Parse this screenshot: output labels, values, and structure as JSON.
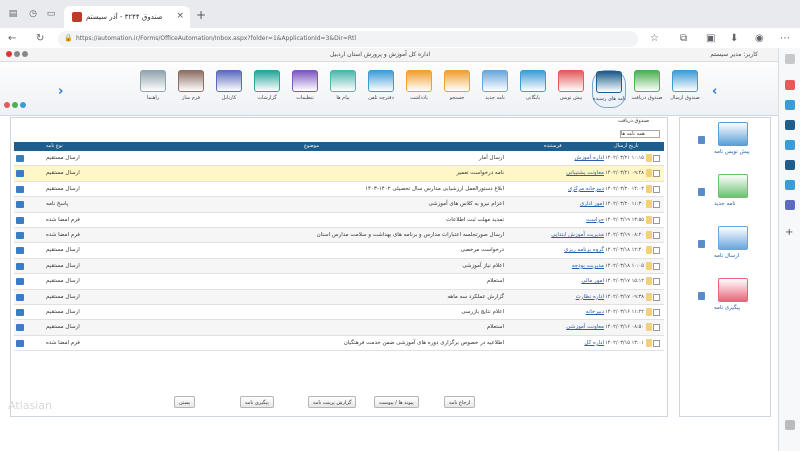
{
  "browser": {
    "tab_title": "صندوق ۳۲۴۴ - آذر سیستم",
    "url": "https://automation.ir/Forms/OfficeAutomation/Inbox.aspx?folder=1&ApplicationId=3&Dir=Rtl",
    "colors": {
      "tabbar": "#e8eaed",
      "accent": "#1f5d8c"
    }
  },
  "app": {
    "title": "اداره کل آموزش و پرورش استان اردبیل",
    "user": "کاربر: مدیر سیستم"
  },
  "toolbar": {
    "items": [
      {
        "label": "صندوق ارسال",
        "color": "#3f9bd6"
      },
      {
        "label": "صندوق دریافت",
        "color": "#4caf50"
      },
      {
        "label": "نامه های رسیده",
        "color": "#1f5d8c"
      },
      {
        "label": "پیش نویس",
        "color": "#e35b5b"
      },
      {
        "label": "بایگانی",
        "color": "#3f9bd6"
      },
      {
        "label": "نامه جدید",
        "color": "#6aa6de"
      },
      {
        "label": "جستجو",
        "color": "#f0a030"
      },
      {
        "label": "یادداشت",
        "color": "#f0a030"
      },
      {
        "label": "دفترچه تلفن",
        "color": "#3f9bd6"
      },
      {
        "label": "پیام ها",
        "color": "#4db6ac"
      },
      {
        "label": "تنظیمات",
        "color": "#7e57c2"
      },
      {
        "label": "گزارشات",
        "color": "#26a69a"
      },
      {
        "label": "کارتابل",
        "color": "#5c6bc0"
      },
      {
        "label": "فرم ساز",
        "color": "#8d6e63"
      },
      {
        "label": "راهنما",
        "color": "#90a4ae"
      }
    ]
  },
  "main": {
    "breadcrumb": "صندوق دریافت",
    "filter_label": "همه نامه ها",
    "columns": {
      "date": "تاریخ ارسال",
      "sender": "فرستنده",
      "subject": "موضوع",
      "from": "نوع نامه"
    },
    "rows": [
      {
        "date": "۱۴۰۲/۰۳/۲۱ ۱۰:۱۵",
        "sender": "اداره آموزش",
        "subject": "ارسال آمار",
        "from": "ارسال مستقیم"
      },
      {
        "date": "۱۴۰۲/۰۳/۲۱ ۰۹:۴۸",
        "sender": "معاونت پشتیبانی",
        "subject": "نامه درخواست تعمیر",
        "from": "ارسال مستقیم"
      },
      {
        "date": "۱۴۰۲/۰۳/۲۰ ۱۴:۰۲",
        "sender": "دبیرخانه مرکزی",
        "subject": "ابلاغ دستورالعمل ارزشیابی مدارس سال تحصیلی ۱۴۰۲-۱۴۰۳",
        "from": "ارسال مستقیم"
      },
      {
        "date": "۱۴۰۲/۰۳/۲۰ ۱۱:۳۰",
        "sender": "امور اداری",
        "subject": "اعزام نیرو به کلاس های آموزشی",
        "from": "پاسخ نامه"
      },
      {
        "date": "۱۴۰۲/۰۳/۱۹ ۱۳:۵۵",
        "sender": "حراست",
        "subject": "تمدید مهلت ثبت اطلاعات",
        "from": "فرم امضا شده"
      },
      {
        "date": "۱۴۰۲/۰۳/۱۹ ۰۸:۲۰",
        "sender": "مدیریت آموزش ابتدایی",
        "subject": "ارسال صورتجلسه اعتبارات مدارس و برنامه های بهداشت و سلامت مدارس استان",
        "from": "فرم امضا شده"
      },
      {
        "date": "۱۴۰۲/۰۳/۱۸ ۱۲:۴۰",
        "sender": "گروه برنامه ریزی",
        "subject": "درخواست مرخصی",
        "from": "ارسال مستقیم"
      },
      {
        "date": "۱۴۰۲/۰۳/۱۸ ۱۰:۰۵",
        "sender": "مدیریت بودجه",
        "subject": "اعلام نیاز آموزشی",
        "from": "ارسال مستقیم"
      },
      {
        "date": "۱۴۰۲/۰۳/۱۷ ۱۵:۱۲",
        "sender": "امور مالی",
        "subject": "استعلام",
        "from": "ارسال مستقیم"
      },
      {
        "date": "۱۴۰۲/۰۳/۱۷ ۰۹:۳۸",
        "sender": "اداره نظارت",
        "subject": "گزارش عملکرد سه ماهه",
        "from": "ارسال مستقیم"
      },
      {
        "date": "۱۴۰۲/۰۳/۱۶ ۱۱:۲۲",
        "sender": "دبیرخانه",
        "subject": "اعلام نتایج بازرسی",
        "from": "ارسال مستقیم"
      },
      {
        "date": "۱۴۰۲/۰۳/۱۶ ۰۸:۵۰",
        "sender": "معاونت آموزشی",
        "subject": "استعلام",
        "from": "ارسال مستقیم"
      },
      {
        "date": "۱۴۰۲/۰۳/۱۵ ۱۳:۰۱",
        "sender": "اداره کل",
        "subject": "اطلاعیه در خصوص برگزاری دوره های آموزشی ضمن خدمت فرهنگیان",
        "from": "فرم امضا شده"
      }
    ]
  },
  "bottom_buttons": [
    {
      "label": "ارجاع نامه"
    },
    {
      "label": "پیوند ها / پیوست"
    },
    {
      "label": "گزارش پرینت نامه"
    },
    {
      "label": "پیگیری نامه"
    },
    {
      "label": "بستن"
    }
  ],
  "watermark": "Atlasian",
  "right_panel": [
    {
      "label": "پیش نویس نامه",
      "color": "#5a9fd8"
    },
    {
      "label": "نامه جدید",
      "color": "#6cc070"
    },
    {
      "label": "ارسال نامه",
      "color": "#6aa6de"
    },
    {
      "label": "پیگیری نامه",
      "color": "#e9657a"
    }
  ]
}
